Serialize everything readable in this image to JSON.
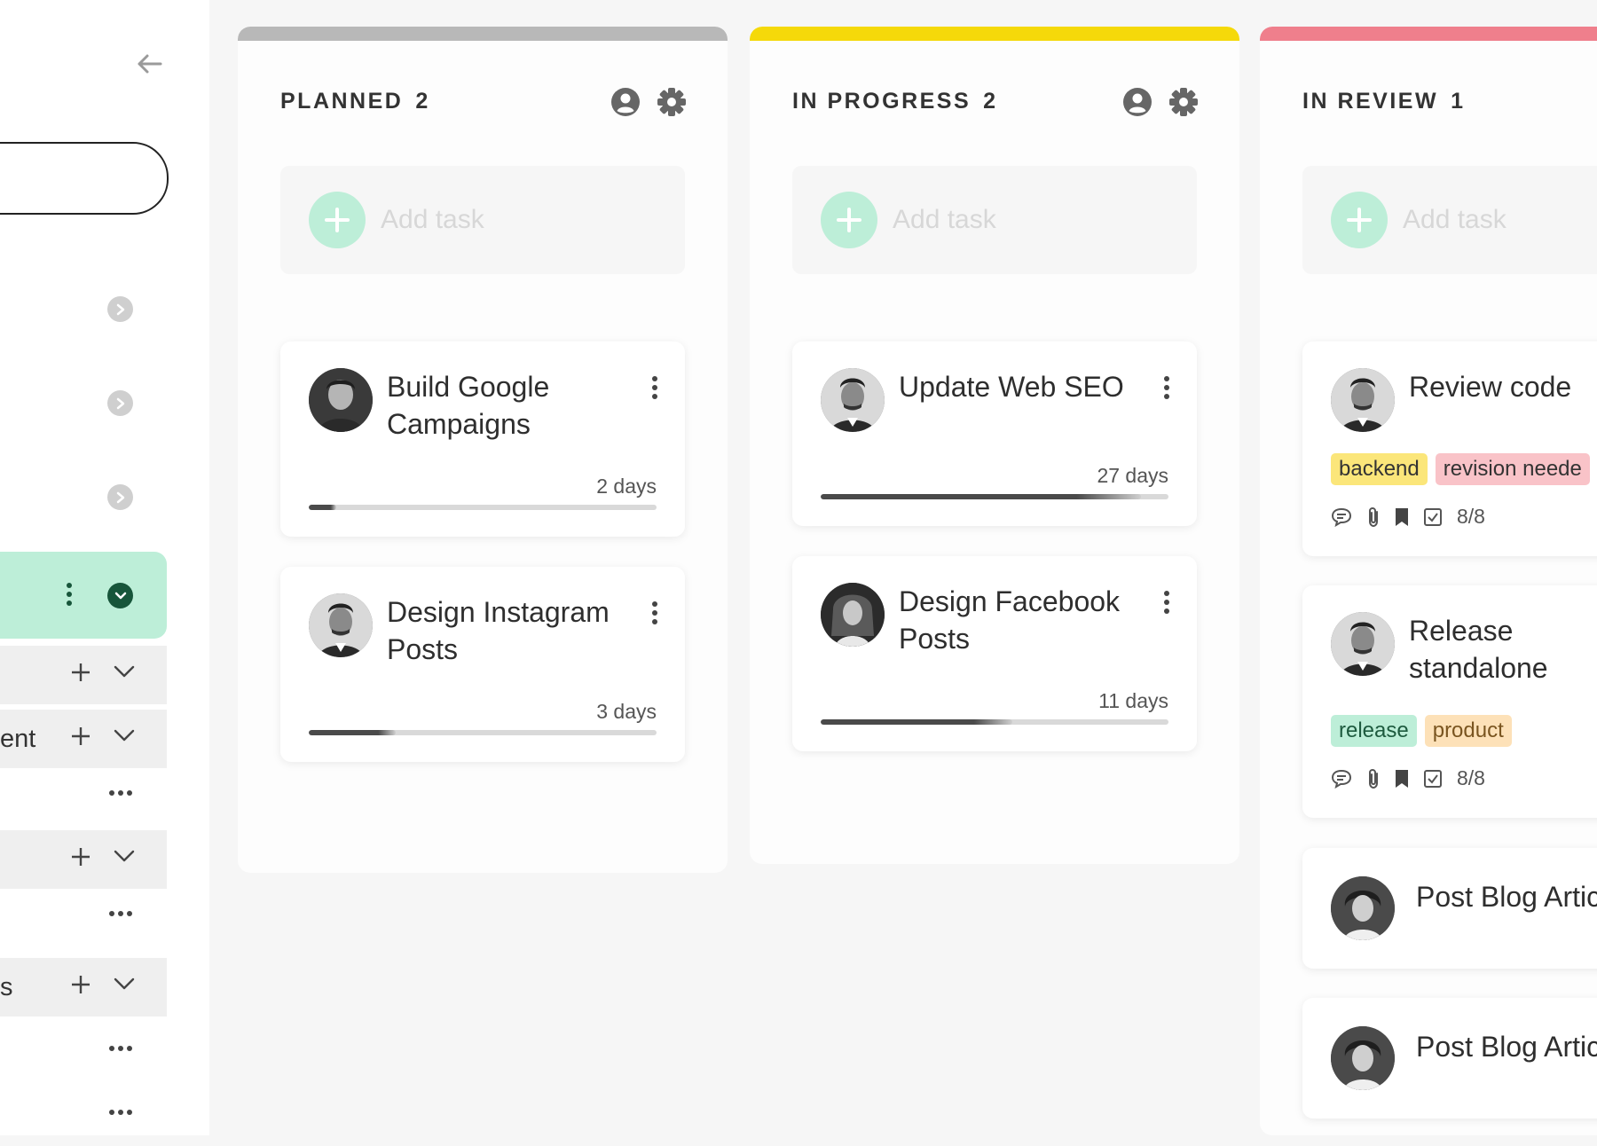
{
  "colors": {
    "accent_mint": "#bdeed8",
    "accent_dark_green": "#17553a",
    "planned_bar": "#b8b8b8",
    "in_progress_bar": "#f5d90a",
    "in_review_bar": "#ef7f8c"
  },
  "sidebar": {
    "back_icon": "arrow-left-icon",
    "rows": [
      {
        "label": "",
        "actions": [
          "plus-icon",
          "chevron-down-icon"
        ]
      },
      {
        "label": "ent",
        "actions": [
          "plus-icon",
          "chevron-down-icon"
        ]
      },
      {
        "label": "",
        "actions": [
          "more-horizontal-icon"
        ]
      },
      {
        "label": "",
        "actions": [
          "plus-icon",
          "chevron-down-icon"
        ]
      },
      {
        "label": "",
        "actions": [
          "more-horizontal-icon"
        ]
      },
      {
        "label": "s",
        "actions": [
          "plus-icon",
          "chevron-down-icon"
        ]
      },
      {
        "label": "",
        "actions": [
          "more-horizontal-icon"
        ]
      },
      {
        "label": "",
        "actions": [
          "more-horizontal-icon"
        ]
      }
    ]
  },
  "columns": [
    {
      "title": "PLANNED",
      "count": "2",
      "add_task_label": "Add task",
      "cards": [
        {
          "title": "Build Google Campaigns",
          "days": "2 days",
          "progress": 0.08
        },
        {
          "title": "Design Instagram Posts",
          "days": "3 days",
          "progress": 0.25
        }
      ]
    },
    {
      "title": "IN PROGRESS",
      "count": "2",
      "add_task_label": "Add task",
      "cards": [
        {
          "title": "Update Web SEO",
          "days": "27 days",
          "progress": 0.92
        },
        {
          "title": "Design Facebook Posts",
          "days": "11 days",
          "progress": 0.55
        }
      ]
    },
    {
      "title": "IN REVIEW",
      "count": "1",
      "add_task_label": "Add task",
      "cards": [
        {
          "title": "Review code",
          "tags": [
            {
              "label": "backend",
              "bg": "#fbe67a",
              "fg": "#333333"
            },
            {
              "label": "revision neede",
              "bg": "#f9c3c8",
              "fg": "#333333"
            }
          ],
          "meta": "8/8"
        },
        {
          "title": "Release standalone",
          "tags": [
            {
              "label": "release",
              "bg": "#bdeed8",
              "fg": "#1d5a3e"
            },
            {
              "label": "product",
              "bg": "#fde1b8",
              "fg": "#7a5520"
            }
          ],
          "meta": "8/8"
        },
        {
          "title": "Post Blog Artic"
        },
        {
          "title": "Post Blog Artic"
        }
      ]
    }
  ]
}
